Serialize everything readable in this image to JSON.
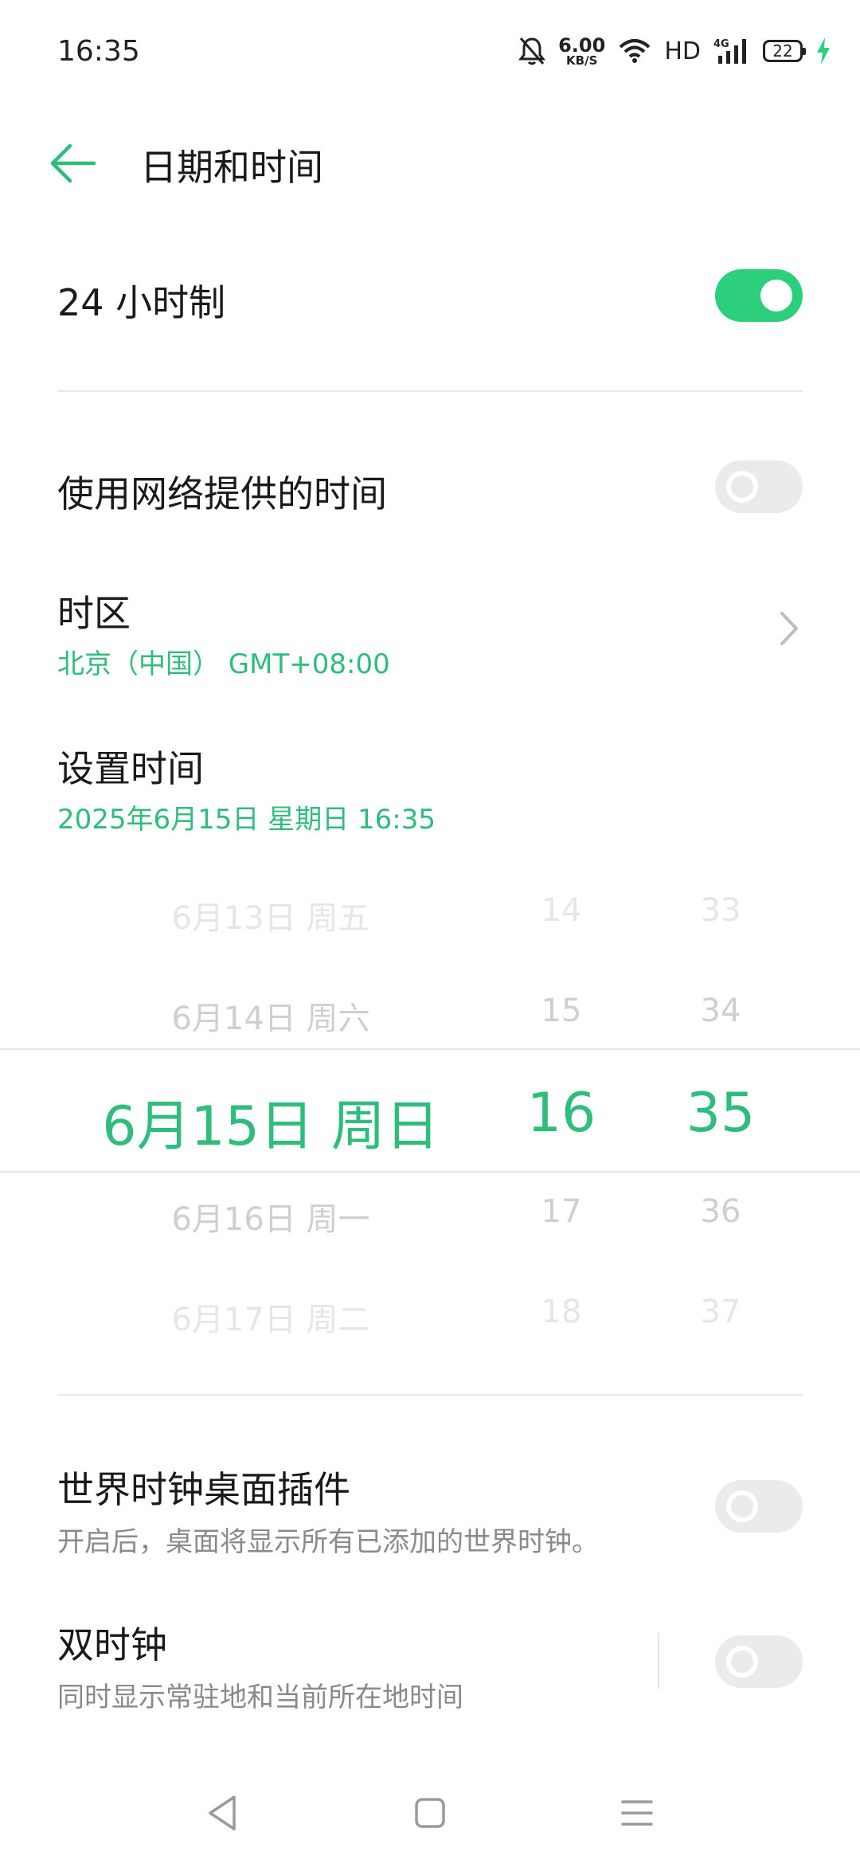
{
  "status_bar": {
    "time": "16:35",
    "net_speed_value": "6.00",
    "net_speed_unit": "KB/S",
    "hd_label": "HD",
    "signal_label": "4G",
    "battery_level": "22",
    "icons": [
      "bell-off-icon",
      "wifi-icon",
      "signal-icon",
      "battery-icon",
      "charging-bolt-icon"
    ]
  },
  "header": {
    "title": "日期和时间",
    "back_icon": "back-arrow-icon"
  },
  "settings": {
    "hour24": {
      "label": "24 小时制",
      "enabled": true
    },
    "network_time": {
      "label": "使用网络提供的时间",
      "enabled": false
    },
    "timezone": {
      "label": "时区",
      "value": "北京（中国） GMT+08:00"
    },
    "set_time": {
      "label": "设置时间",
      "value": "2025年6月15日 星期日  16:35"
    },
    "world_clock": {
      "label": "世界时钟桌面插件",
      "description": "开启后，桌面将显示所有已添加的世界时钟。",
      "enabled": false
    },
    "dual_clock": {
      "label": "双时钟",
      "description": "同时显示常驻地和当前所在地时间",
      "enabled": false
    }
  },
  "picker": {
    "dates": [
      "6月13日 周五",
      "6月14日 周六",
      "6月15日 周日",
      "6月16日 周一",
      "6月17日 周二"
    ],
    "hours": [
      "14",
      "15",
      "16",
      "17",
      "18"
    ],
    "minutes": [
      "33",
      "34",
      "35",
      "36",
      "37"
    ],
    "selected_index": 2
  },
  "nav_bar": {
    "icons": [
      "back-triangle-icon",
      "home-square-icon",
      "menu-lines-icon"
    ]
  },
  "colors": {
    "accent": "#2ebd7b",
    "toggle_on": "#2ccf7c",
    "toggle_off": "#ebebeb"
  }
}
